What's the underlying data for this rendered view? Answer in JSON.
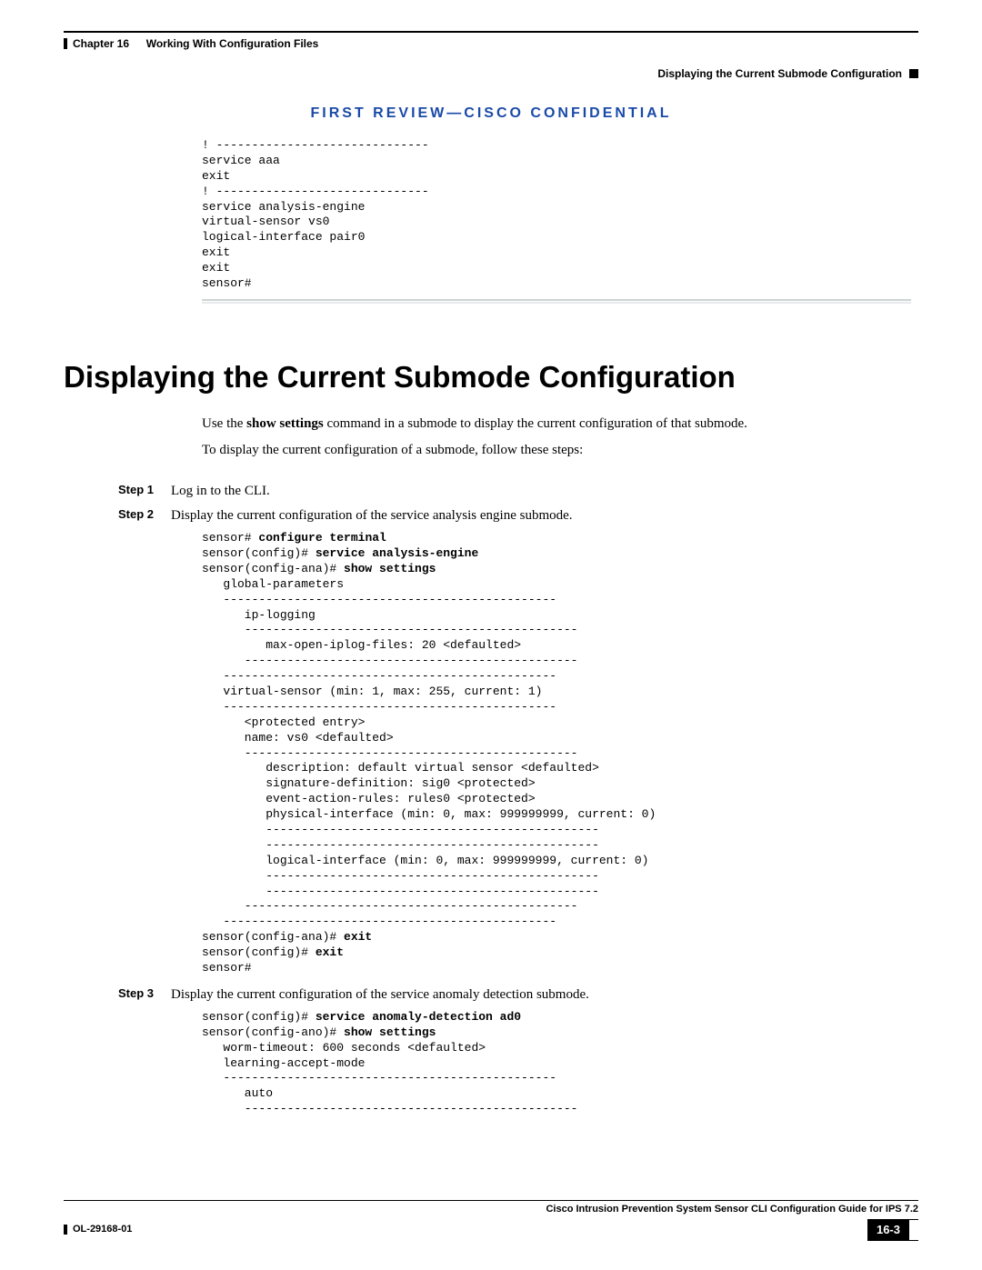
{
  "header": {
    "chapter": "Chapter 16",
    "chapter_title": "Working With Configuration Files",
    "topic": "Displaying the Current Submode Configuration"
  },
  "review_banner": "FIRST REVIEW—CISCO CONFIDENTIAL",
  "top_code": "! ------------------------------\nservice aaa\nexit\n! ------------------------------\nservice analysis-engine\nvirtual-sensor vs0\nlogical-interface pair0\nexit\nexit\nsensor#",
  "section_title": "Displaying the Current Submode Configuration",
  "intro": {
    "p1_pre": "Use the ",
    "p1_bold": "show settings",
    "p1_post": " command in a submode to display the current configuration of that submode.",
    "p2": "To display the current configuration of a submode, follow these steps:"
  },
  "steps": [
    {
      "label": "Step 1",
      "text": "Log in to the CLI."
    },
    {
      "label": "Step 2",
      "text": "Display the current configuration of the service analysis engine submode."
    },
    {
      "label": "Step 3",
      "text": "Display the current configuration of the service anomaly detection submode."
    }
  ],
  "code2": {
    "l1a": "sensor# ",
    "l1b": "configure terminal",
    "l2a": "sensor(config)# ",
    "l2b": "service analysis-engine",
    "l3a": "sensor(config-ana)# ",
    "l3b": "show settings",
    "rest": "   global-parameters\n   -----------------------------------------------\n      ip-logging\n      -----------------------------------------------\n         max-open-iplog-files: 20 <defaulted>\n      -----------------------------------------------\n   -----------------------------------------------\n   virtual-sensor (min: 1, max: 255, current: 1)\n   -----------------------------------------------\n      <protected entry>\n      name: vs0 <defaulted>\n      -----------------------------------------------\n         description: default virtual sensor <defaulted>\n         signature-definition: sig0 <protected>\n         event-action-rules: rules0 <protected>\n         physical-interface (min: 0, max: 999999999, current: 0)\n         -----------------------------------------------\n         -----------------------------------------------\n         logical-interface (min: 0, max: 999999999, current: 0)\n         -----------------------------------------------\n         -----------------------------------------------\n      -----------------------------------------------\n   -----------------------------------------------",
    "l4a": "sensor(config-ana)# ",
    "l4b": "exit",
    "l5a": "sensor(config)# ",
    "l5b": "exit",
    "l6": "sensor#"
  },
  "code3": {
    "l1a": "sensor(config)# ",
    "l1b": "service anomaly-detection ad0",
    "l2a": "sensor(config-ano)# ",
    "l2b": "show settings",
    "rest": "   worm-timeout: 600 seconds <defaulted>\n   learning-accept-mode\n   -----------------------------------------------\n      auto\n      -----------------------------------------------"
  },
  "footer": {
    "guide": "Cisco Intrusion Prevention System Sensor CLI Configuration Guide for IPS 7.2",
    "docnum": "OL-29168-01",
    "pagenum": "16-3"
  }
}
